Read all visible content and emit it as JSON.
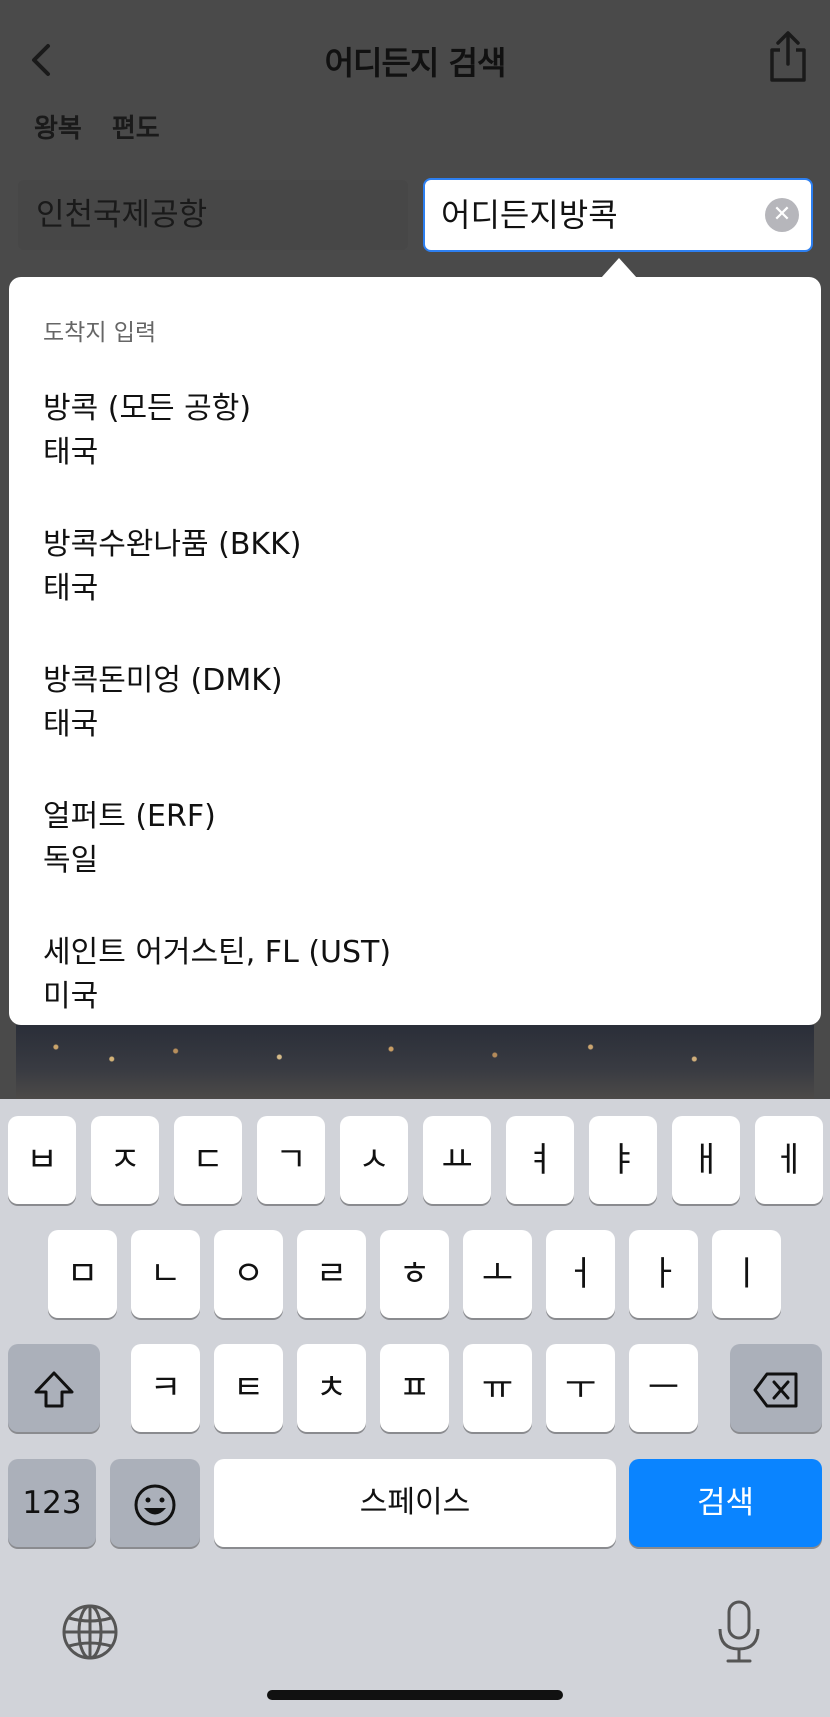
{
  "header": {
    "title": "어디든지 검색",
    "back_icon": "chevron-left-icon",
    "share_icon": "share-icon"
  },
  "trip_tabs": [
    "왕복",
    "편도"
  ],
  "search": {
    "origin_value": "인천국제공항",
    "destination_value": "어디든지방콕",
    "clear_icon": "clear-circle-icon"
  },
  "dropdown": {
    "header": "도착지 입력",
    "results": [
      {
        "name": "방콕 (모든 공항)",
        "country": "태국"
      },
      {
        "name": "방콕수완나품 (BKK)",
        "country": "태국"
      },
      {
        "name": "방콕돈미엉 (DMK)",
        "country": "태국"
      },
      {
        "name": "얼퍼트 (ERF)",
        "country": "독일"
      },
      {
        "name": "세인트 어거스틴, FL (UST)",
        "country": "미국"
      }
    ]
  },
  "keyboard": {
    "row1": [
      "ㅂ",
      "ㅈ",
      "ㄷ",
      "ㄱ",
      "ㅅ",
      "ㅛ",
      "ㅕ",
      "ㅑ",
      "ㅐ",
      "ㅔ"
    ],
    "row2": [
      "ㅁ",
      "ㄴ",
      "ㅇ",
      "ㄹ",
      "ㅎ",
      "ㅗ",
      "ㅓ",
      "ㅏ",
      "ㅣ"
    ],
    "row3": [
      "ㅋ",
      "ㅌ",
      "ㅊ",
      "ㅍ",
      "ㅠ",
      "ㅜ",
      "ㅡ"
    ],
    "numbers_label": "123",
    "space_label": "스페이스",
    "search_label": "검색",
    "shift_icon": "shift-icon",
    "delete_icon": "backspace-icon",
    "emoji_icon": "emoji-icon",
    "globe_icon": "globe-icon",
    "mic_icon": "microphone-icon"
  },
  "colors": {
    "accent": "#0a84ff",
    "field_border": "#2d7ff0",
    "overlay": "#4a4a4a",
    "keyboard_bg": "#d1d3d9"
  }
}
